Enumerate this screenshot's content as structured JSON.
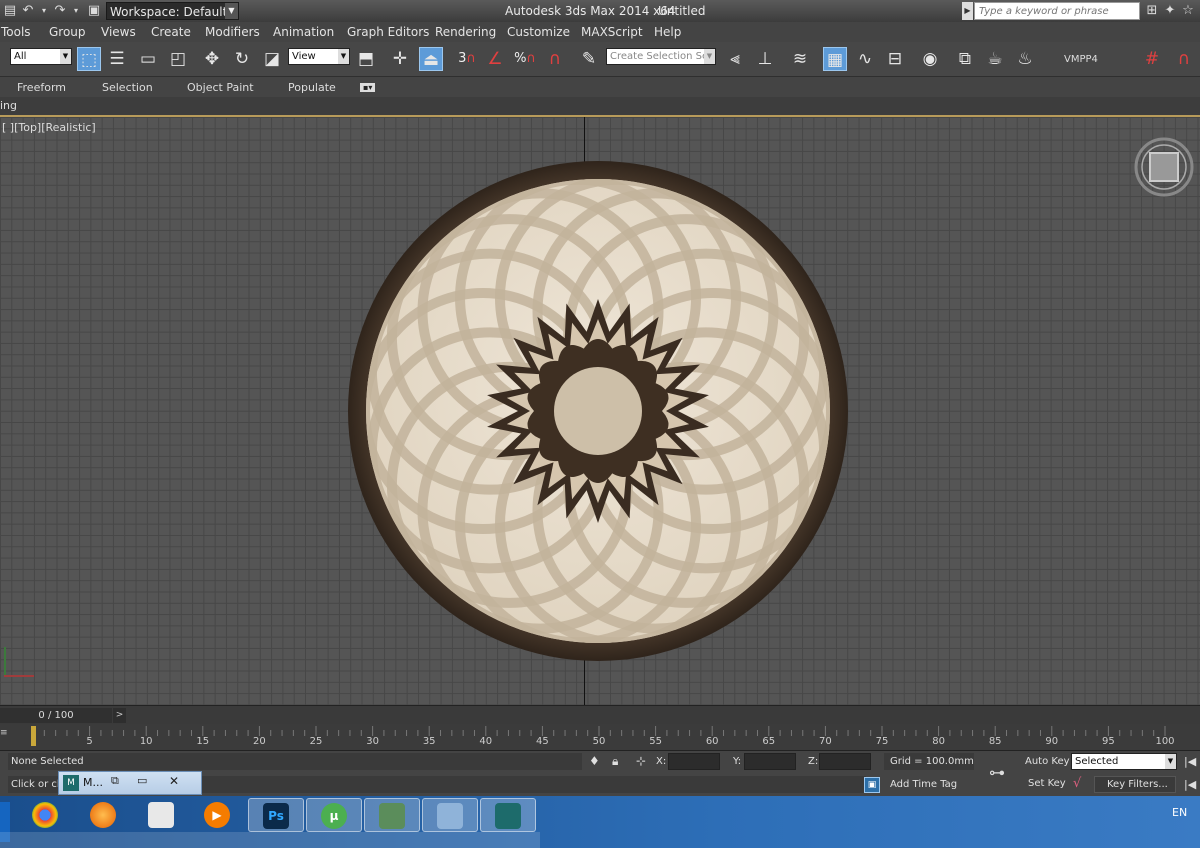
{
  "titlebar": {
    "workspace": "Workspace: Default",
    "app_title": "Autodesk 3ds Max  2014 x64",
    "doc_title": "Untitled",
    "search_placeholder": "Type a keyword or phrase"
  },
  "menu": [
    "Tools",
    "Group",
    "Views",
    "Create",
    "Modifiers",
    "Animation",
    "Graph Editors",
    "Rendering",
    "Customize",
    "MAXScript",
    "Help"
  ],
  "toolbar": {
    "filter_value": "All",
    "refcoord_value": "View",
    "selection_set_placeholder": "Create Selection Se",
    "snap_labels": [
      "3",
      "%"
    ],
    "vmpp4": "VMPP4"
  },
  "ribbon": {
    "tabs": [
      "Freeform",
      "Selection",
      "Object Paint",
      "Populate"
    ],
    "panel_label": "ing"
  },
  "viewport": {
    "label": "[ ][Top][Realistic]"
  },
  "timeline": {
    "frame_counter": "0 / 100",
    "next": ">",
    "ticks": [
      "5",
      "10",
      "15",
      "20",
      "25",
      "30",
      "35",
      "40",
      "45",
      "50",
      "55",
      "60",
      "65",
      "70",
      "75",
      "80",
      "85",
      "90",
      "95",
      "100"
    ]
  },
  "status": {
    "selection": "None Selected",
    "prompt": "Click or cli",
    "x_label": "X:",
    "y_label": "Y:",
    "z_label": "Z:",
    "grid": "Grid = 100.0mm",
    "add_time_tag": "Add Time Tag",
    "auto_key": "Auto Key",
    "set_key": "Set Key",
    "key_mode": "Selected",
    "key_filters": "Key Filters..."
  },
  "popup": {
    "label": "M..."
  },
  "taskbar": {
    "apps": [
      "chrome-icon",
      "firefox-icon",
      "calculator-icon",
      "media-player-icon",
      "photoshop-icon",
      "utorrent-icon",
      "network-icon",
      "computer-icon",
      "3dsmax-icon"
    ],
    "ps_label": "Ps",
    "utorrent_label": "µ",
    "lang": "EN"
  },
  "colors": {
    "accent": "#5d9bd8",
    "marble_light": "#e8dccb",
    "marble_dark": "#3e2f22",
    "taskbar": "#2d6eb7"
  }
}
